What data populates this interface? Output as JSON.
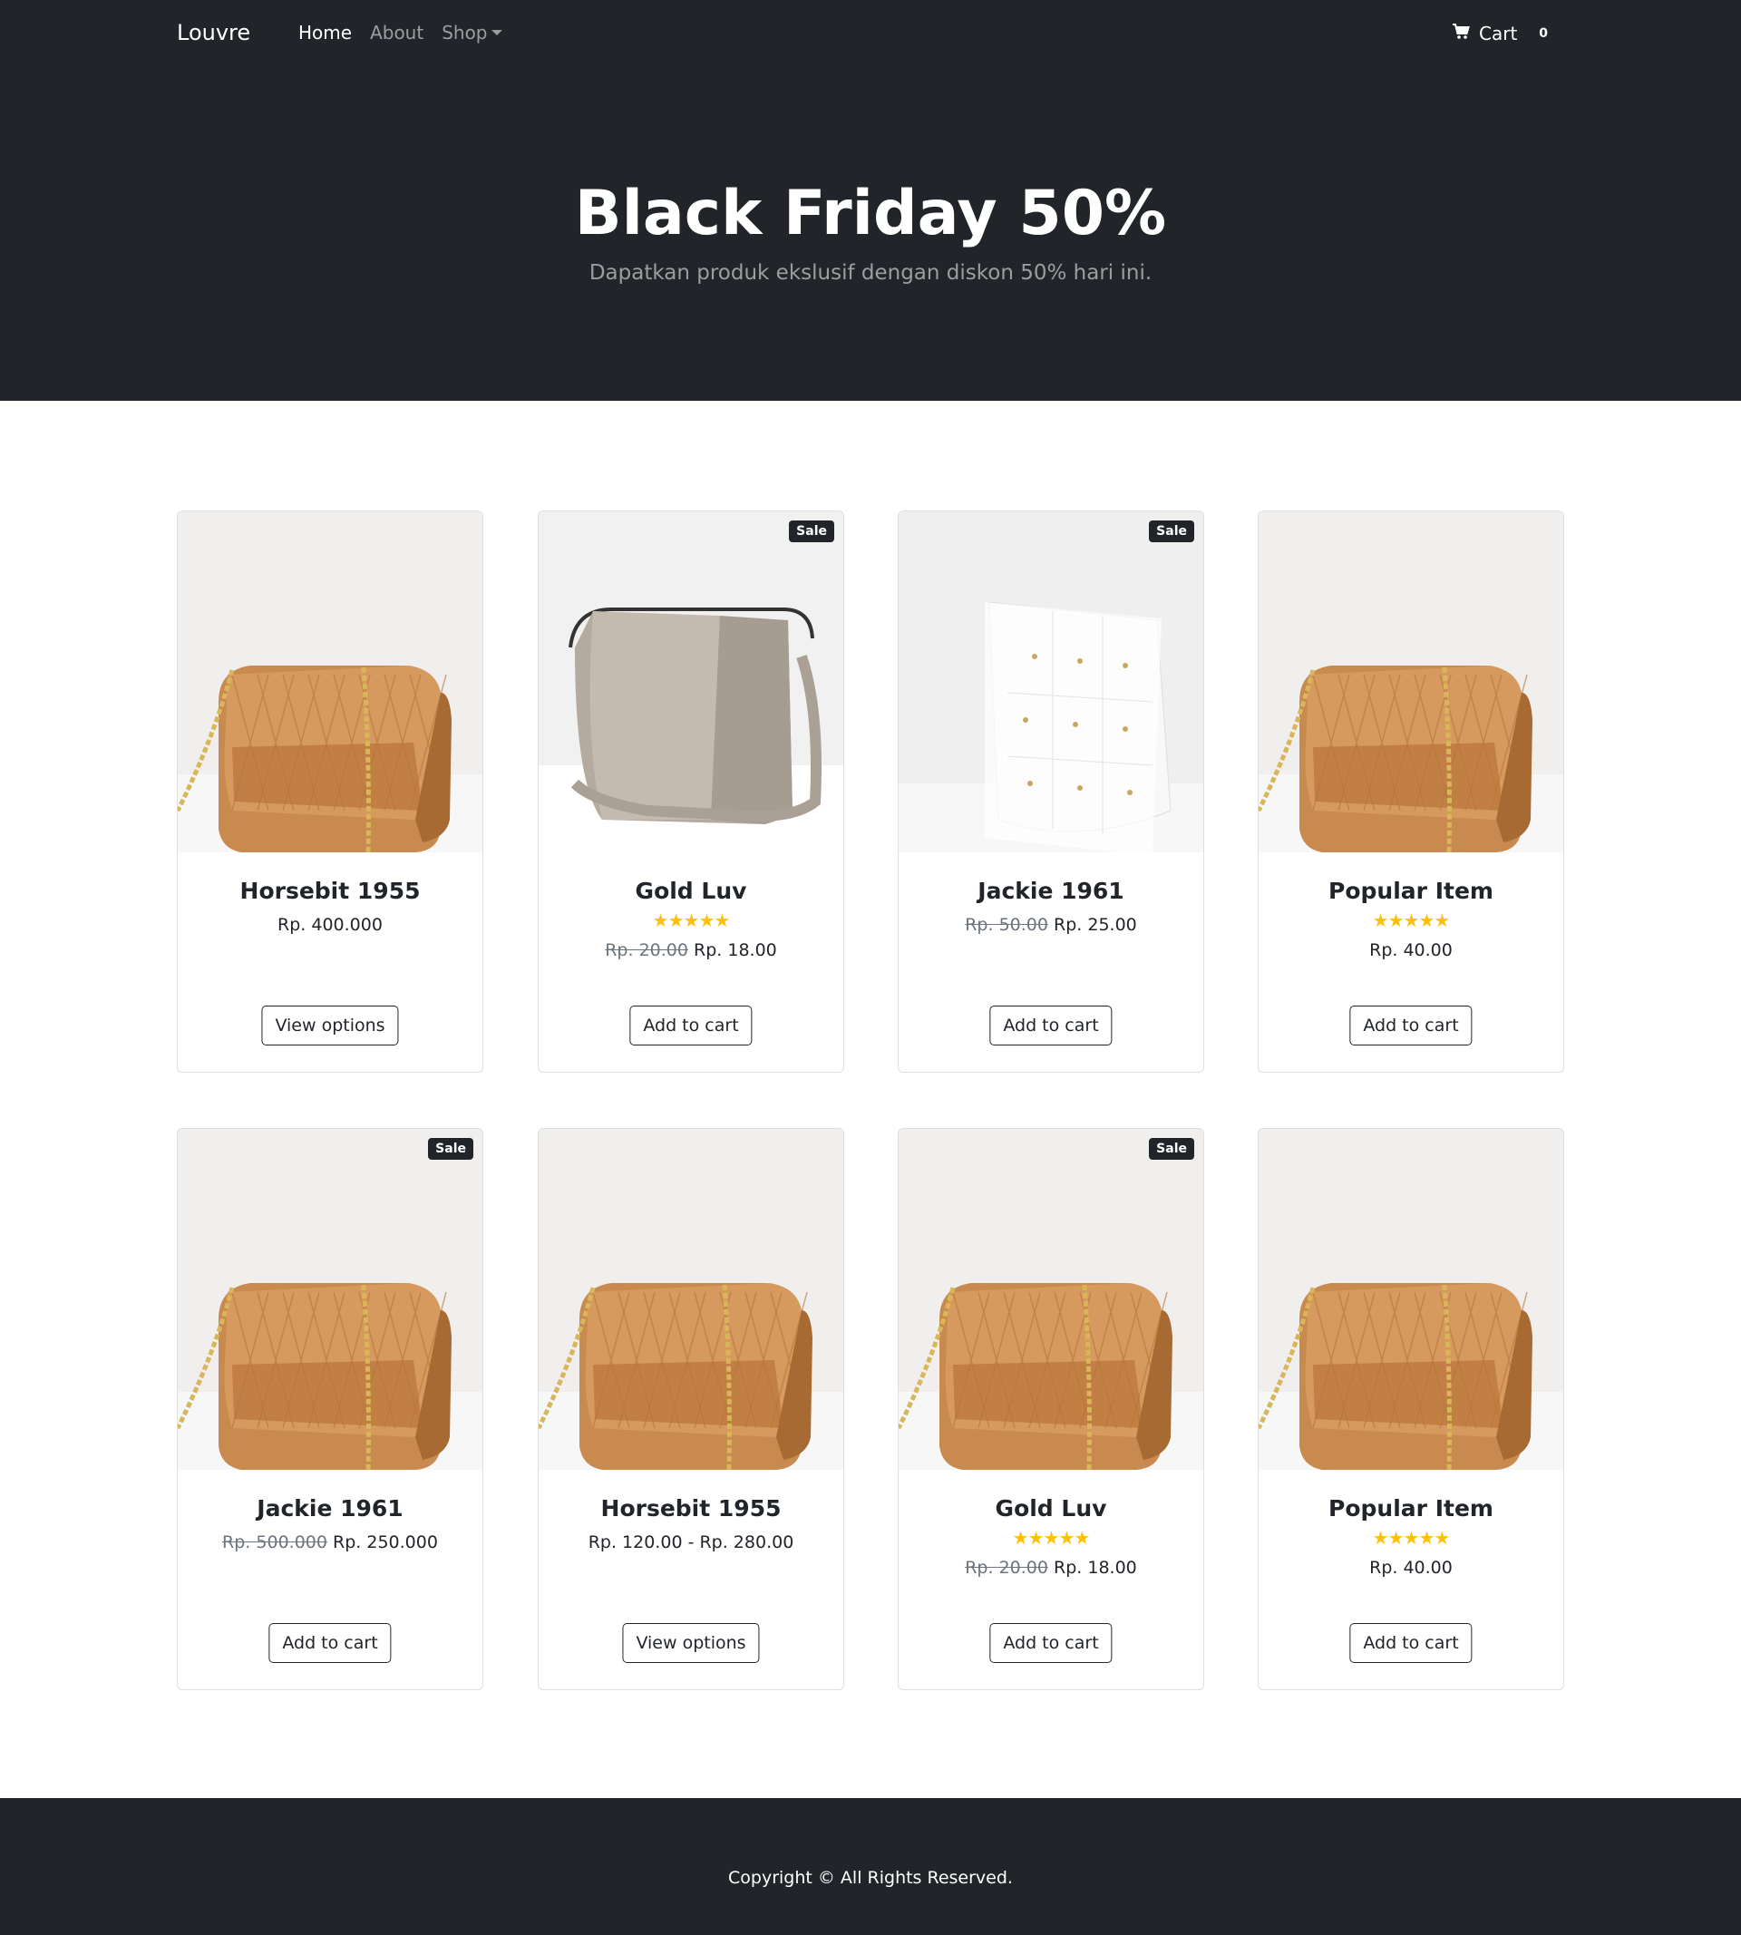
{
  "nav": {
    "brand": "Louvre",
    "links": [
      "Home",
      "About",
      "Shop"
    ],
    "cart_label": "Cart",
    "cart_count": "0"
  },
  "hero": {
    "title": "Black Friday 50%",
    "subtitle": "Dapatkan produk ekslusif dengan diskon 50% hari ini."
  },
  "products": [
    {
      "name": "Horsebit 1955",
      "old_price": "",
      "price": "Rp. 400.000",
      "stars": "",
      "badge": "",
      "button": "View options",
      "image": "tan-bag"
    },
    {
      "name": "Gold Luv",
      "old_price": "Rp. 20.00",
      "price": "Rp. 18.00",
      "stars": "★★★★★",
      "badge": "Sale",
      "button": "Add to cart",
      "image": "grey-bag"
    },
    {
      "name": "Jackie 1961",
      "old_price": "Rp. 50.00",
      "price": "Rp. 25.00",
      "stars": "",
      "badge": "Sale",
      "button": "Add to cart",
      "image": "white-bag"
    },
    {
      "name": "Popular Item",
      "old_price": "",
      "price": "Rp. 40.00",
      "stars": "★★★★★",
      "badge": "",
      "button": "Add to cart",
      "image": "tan-bag"
    },
    {
      "name": "Jackie 1961",
      "old_price": "Rp. 500.000",
      "price": "Rp. 250.000",
      "stars": "",
      "badge": "Sale",
      "button": "Add to cart",
      "image": "tan-bag"
    },
    {
      "name": "Horsebit 1955",
      "old_price": "",
      "price": "Rp. 120.00 - Rp. 280.00",
      "stars": "",
      "badge": "",
      "button": "View options",
      "image": "tan-bag"
    },
    {
      "name": "Gold Luv",
      "old_price": "Rp. 20.00",
      "price": "Rp. 18.00",
      "stars": "★★★★★",
      "badge": "Sale",
      "button": "Add to cart",
      "image": "tan-bag"
    },
    {
      "name": "Popular Item",
      "old_price": "",
      "price": "Rp. 40.00",
      "stars": "★★★★★",
      "badge": "",
      "button": "Add to cart",
      "image": "tan-bag"
    }
  ],
  "footer": {
    "copyright": "Copyright © All Rights Reserved."
  },
  "colors": {
    "dark": "#212529",
    "star": "#ffc107",
    "muted": "#6c757d"
  }
}
